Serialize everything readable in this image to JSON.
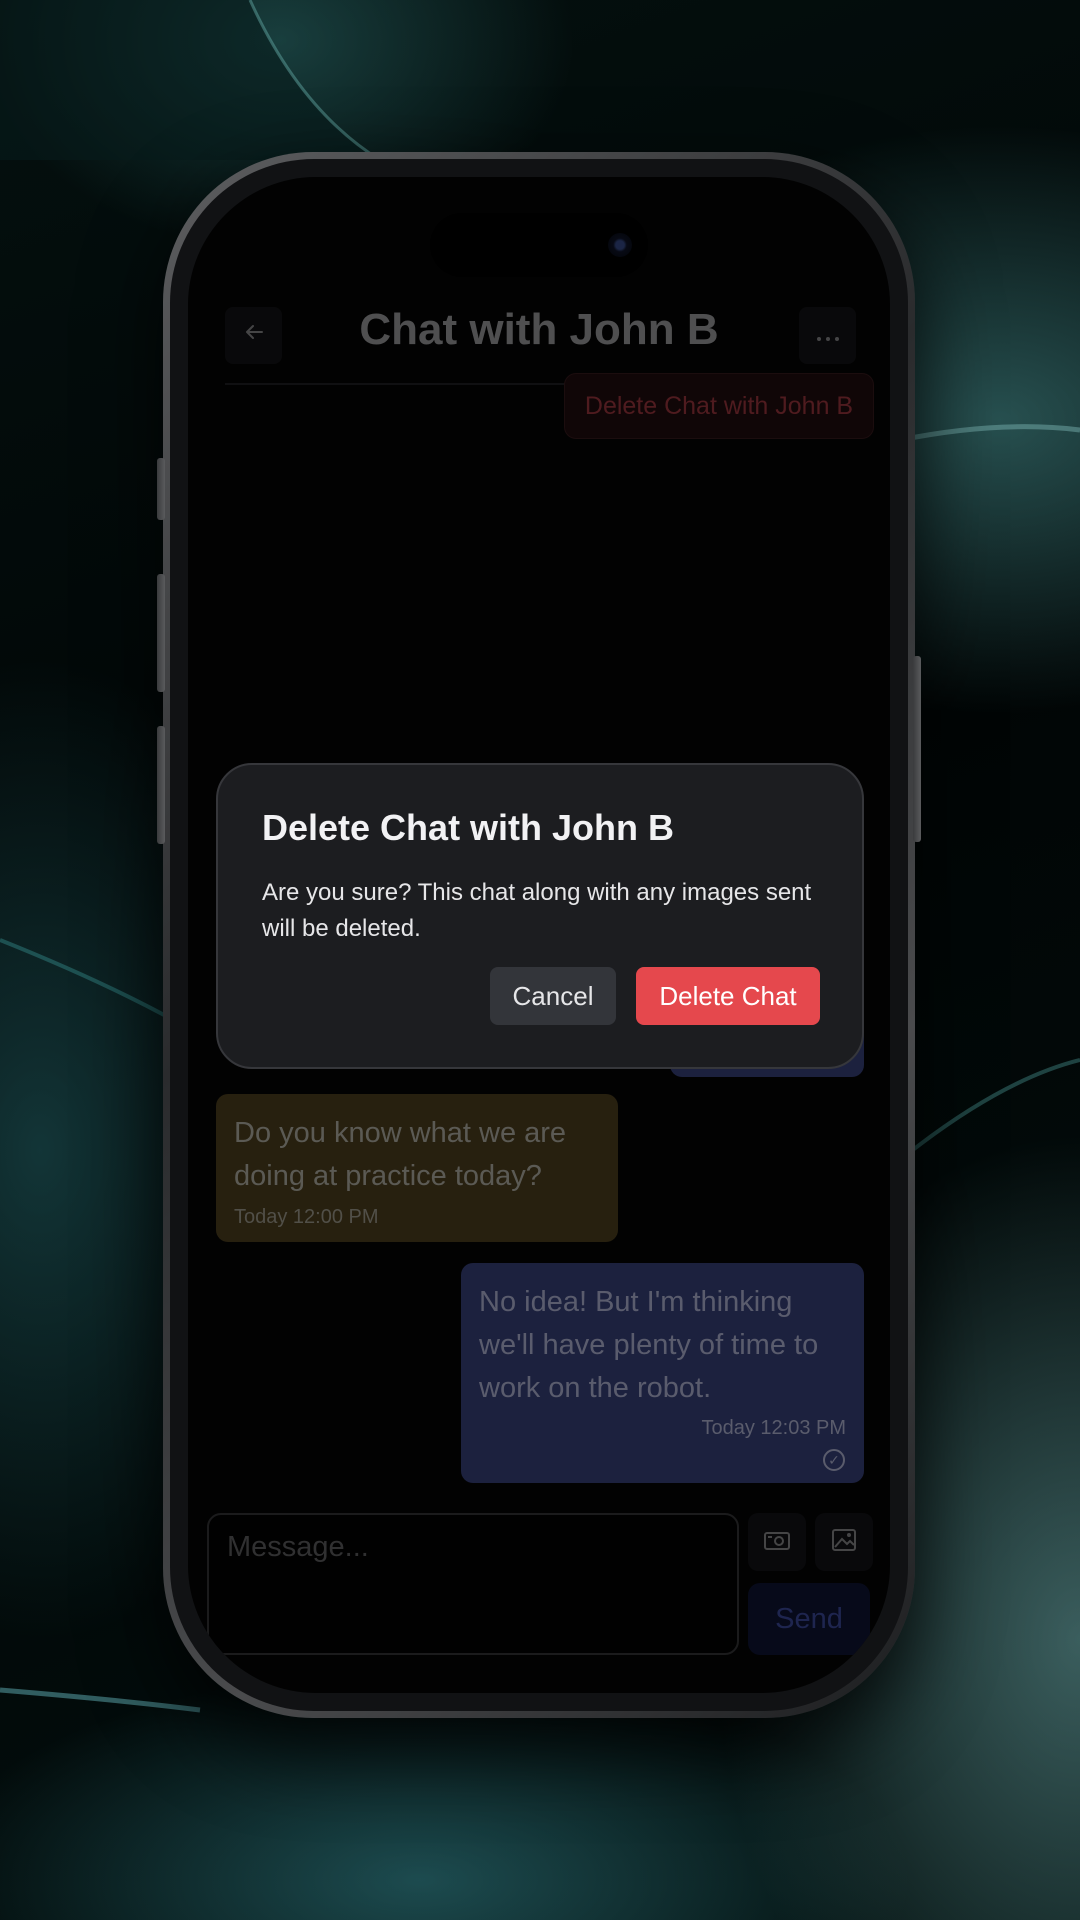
{
  "header": {
    "title": "Chat with John B",
    "menu_item": "Delete Chat with John B"
  },
  "messages": [
    {
      "direction": "in",
      "text": "Do you know what we are doing at practice today?",
      "time": "Today 12:00 PM"
    },
    {
      "direction": "out",
      "text": "No idea! But I'm thinking we'll have plenty of time to work on the robot.",
      "time": "Today 12:03 PM",
      "status": "delivered"
    }
  ],
  "composer": {
    "placeholder": "Message...",
    "send_label": "Send"
  },
  "dialog": {
    "title": "Delete Chat with John B",
    "body": "Are you sure? This chat along with any images sent will be deleted.",
    "cancel_label": "Cancel",
    "confirm_label": "Delete Chat"
  },
  "colors": {
    "accent_danger": "#e5484d",
    "incoming_bubble": "#3d3218",
    "outgoing_bubble": "#2c3360",
    "dialog_bg": "#1c1d20"
  },
  "icons": {
    "back": "arrow-left-icon",
    "more": "ellipsis-icon",
    "camera": "camera-icon",
    "gallery": "image-icon",
    "status": "check-circle-icon"
  }
}
